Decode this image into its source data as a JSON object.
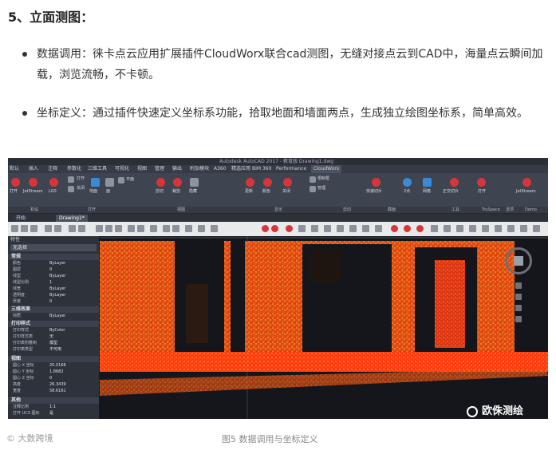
{
  "heading": "5、立面测图：",
  "bullets": [
    "数据调用：徕卡点云应用扩展插件CloudWorx联合cad测图，无缝对接点云到CAD中，海量点云瞬间加载，浏览流畅，不卡顿。",
    "坐标定义：通过插件快速定义坐标系功能，拾取地面和墙面两点，生成独立绘图坐标系，简单高效。"
  ],
  "screenshot": {
    "window_title": "Autodesk AutoCAD 2017 - 教育版   Drawing1.dwg",
    "menu": [
      "默认",
      "插入",
      "注释",
      "参数化",
      "三维工具",
      "可视化",
      "视图",
      "管理",
      "输出",
      "附加模块",
      "A360",
      "精选应用",
      "BIM 360",
      "Performance",
      "CloudWorx"
    ],
    "ribbon_labels": [
      "打开",
      "JetStream",
      "LGS",
      "打开",
      "关闭",
      "地面",
      "面",
      "平面",
      "剪切",
      "裁剪",
      "隐藏",
      "更新",
      "颜色",
      "关闭",
      "限制框",
      "管理",
      "快速切片",
      "2点",
      "网格",
      "正交切片",
      "打开",
      "JetStream"
    ],
    "ribbon_groups": [
      "初设",
      "打开",
      "视图",
      "显示",
      "剪切",
      "截面",
      "工具",
      "TruSpace",
      "选项",
      "Demo"
    ],
    "tabs": [
      "开始",
      "Drawing1*"
    ],
    "panel": {
      "title": "特性",
      "select": "无选择",
      "sections": [
        {
          "name": "常规",
          "rows": [
            [
              "颜色",
              "ByLayer"
            ],
            [
              "图层",
              "0"
            ],
            [
              "线型",
              "ByLayer"
            ],
            [
              "线型比例",
              "1"
            ],
            [
              "线宽",
              "ByLayer"
            ],
            [
              "透明度",
              "ByLayer"
            ],
            [
              "厚度",
              "0"
            ]
          ]
        },
        {
          "name": "三维效果",
          "rows": [
            [
              "材质",
              "ByLayer"
            ]
          ]
        },
        {
          "name": "打印样式",
          "rows": [
            [
              "打印样式",
              "ByColor"
            ],
            [
              "打印样式表",
              "无"
            ],
            [
              "打印表附着到",
              "模型"
            ],
            [
              "打印表类型",
              "不可用"
            ]
          ]
        },
        {
          "name": "视图",
          "rows": [
            [
              "圆心 X 坐标",
              "20.0166"
            ],
            [
              "圆心 Y 坐标",
              "1.8682"
            ],
            [
              "圆心 Z 坐标",
              "0"
            ],
            [
              "高度",
              "26.3439"
            ],
            [
              "宽度",
              "58.6161"
            ]
          ]
        },
        {
          "name": "其他",
          "rows": [
            [
              "注释比例",
              "1:1"
            ],
            [
              "打开 UCS 图标",
              "是"
            ]
          ]
        }
      ]
    },
    "watermark": "欧侏测绘"
  },
  "caption": "图5  数据调用与坐标定义",
  "credit": "大数跨境",
  "colors": {
    "pointcloud_hot": "#ff3a10",
    "pointcloud_warm": "#ff9a1a",
    "pointcloud_yellow": "#f2d23a",
    "panel_bg": "#2d323b"
  }
}
